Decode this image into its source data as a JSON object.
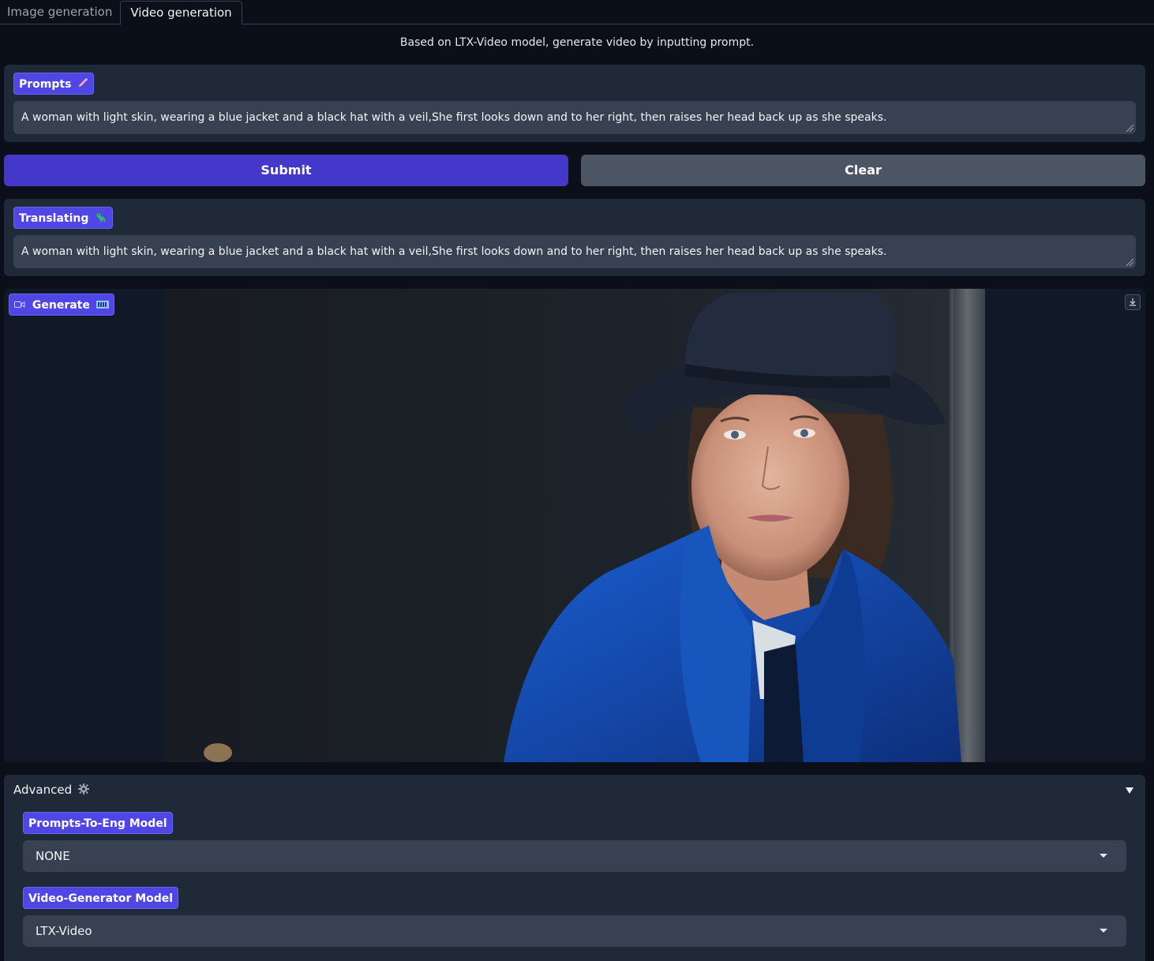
{
  "tabs": [
    {
      "label": "Image generation",
      "active": false
    },
    {
      "label": "Video generation",
      "active": true
    }
  ],
  "description": "Based on LTX-Video model, generate video by inputting prompt.",
  "prompts": {
    "label": "Prompts",
    "icon": "pencil-icon",
    "value": "A woman with light skin, wearing a blue jacket and a black hat with a veil,She first looks down and to her right, then raises her head back up as she speaks."
  },
  "actions": {
    "submit_label": "Submit",
    "clear_label": "Clear"
  },
  "translating": {
    "label": "Translating",
    "icon": "dinosaur-icon",
    "value": "A woman with light skin, wearing a blue jacket and a black hat with a veil,She first looks down and to her right, then raises her head back up as she speaks."
  },
  "generate": {
    "label": "Generate",
    "icon": "video-camera-icon",
    "emoji_icon": "film-frames-icon"
  },
  "advanced": {
    "title": "Advanced",
    "icon": "gear-icon",
    "expanded": true,
    "prompts_model": {
      "label": "Prompts-To-Eng Model",
      "value": "NONE"
    },
    "video_model": {
      "label": "Video-Generator Model",
      "value": "LTX-Video"
    }
  },
  "colors": {
    "accent": "#4f46e5",
    "submit": "#4338ca",
    "clear": "#4b5563",
    "background": "#0b0f19",
    "panel": "#1f2937"
  }
}
